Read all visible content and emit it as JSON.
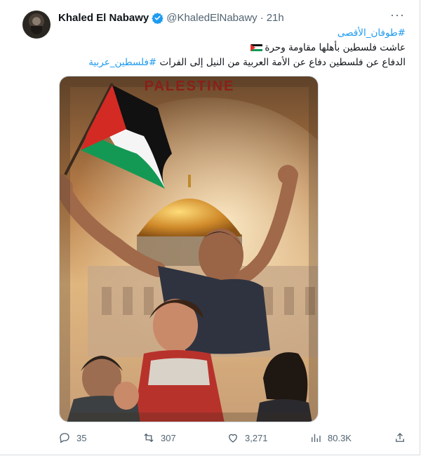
{
  "tweet": {
    "author_name": "Khaled El Nabawy",
    "handle": "@KhaledElNabawy",
    "separator": "·",
    "time": "21h",
    "hashtag_line": "#طوفان_الأقصى",
    "line2": "عاشت فلسطين بأهلها مقاومة وحرة",
    "line3": "الدفاع عن فلسطين دفاع عن الأمة العربية من النيل إلى الفرات",
    "line3_hashtag": "#فلسطين_عربية",
    "media": {
      "poster_title": "PALESTINE",
      "alt": "Palestine poster"
    },
    "stats": {
      "replies": "35",
      "retweets": "307",
      "likes": "3,271",
      "views": "80.3K"
    },
    "colors": {
      "link": "#1d9bf0",
      "verified": "#1d9bf0",
      "muted": "#536471"
    },
    "icons": [
      "verified-badge-icon",
      "more-icon",
      "reply-icon",
      "retweet-icon",
      "like-icon",
      "views-icon",
      "share-icon",
      "palestine-flag-icon"
    ]
  }
}
